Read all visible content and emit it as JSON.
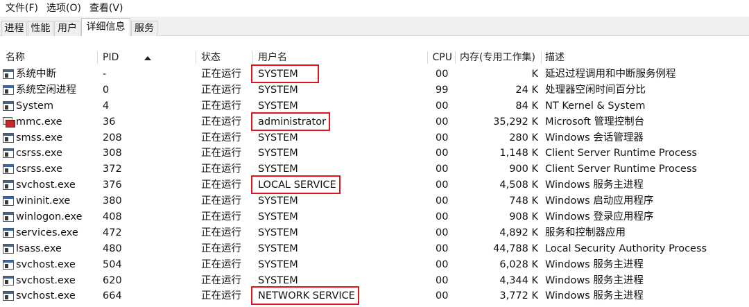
{
  "menu": [
    "文件(F)",
    "选项(O)",
    "查看(V)"
  ],
  "tabs": [
    "进程",
    "性能",
    "用户",
    "详细信息",
    "服务"
  ],
  "active_tab": "详细信息",
  "columns": {
    "name": "名称",
    "pid": "PID",
    "status": "状态",
    "user": "用户名",
    "cpu": "CPU",
    "memory": "内存(专用工作集)",
    "description": "描述"
  },
  "sort": {
    "column": "PID",
    "direction": "ascending"
  },
  "highlight_color": "#e0141e",
  "rows": [
    {
      "name": "系统中断",
      "pid": "-",
      "status": "正在运行",
      "user": "SYSTEM",
      "cpu": "00",
      "memory": "K",
      "description": "延迟过程调用和中断服务例程",
      "icon": "window-icon",
      "highlighted": true
    },
    {
      "name": "系统空闲进程",
      "pid": "0",
      "status": "正在运行",
      "user": "SYSTEM",
      "cpu": "99",
      "memory": "24 K",
      "description": "处理器空闲时间百分比",
      "icon": "window-icon",
      "highlighted": false
    },
    {
      "name": "System",
      "pid": "4",
      "status": "正在运行",
      "user": "SYSTEM",
      "cpu": "00",
      "memory": "84 K",
      "description": "NT Kernel & System",
      "icon": "window-icon",
      "highlighted": false
    },
    {
      "name": "mmc.exe",
      "pid": "36",
      "status": "正在运行",
      "user": "administrator",
      "cpu": "00",
      "memory": "35,292 K",
      "description": "Microsoft 管理控制台",
      "icon": "mmc-icon",
      "highlighted": true
    },
    {
      "name": "smss.exe",
      "pid": "208",
      "status": "正在运行",
      "user": "SYSTEM",
      "cpu": "00",
      "memory": "280 K",
      "description": "Windows 会话管理器",
      "icon": "window-icon",
      "highlighted": false
    },
    {
      "name": "csrss.exe",
      "pid": "308",
      "status": "正在运行",
      "user": "SYSTEM",
      "cpu": "00",
      "memory": "1,148 K",
      "description": "Client Server Runtime Process",
      "icon": "window-icon",
      "highlighted": false
    },
    {
      "name": "csrss.exe",
      "pid": "372",
      "status": "正在运行",
      "user": "SYSTEM",
      "cpu": "00",
      "memory": "900 K",
      "description": "Client Server Runtime Process",
      "icon": "window-icon",
      "highlighted": false
    },
    {
      "name": "svchost.exe",
      "pid": "376",
      "status": "正在运行",
      "user": "LOCAL SERVICE",
      "cpu": "00",
      "memory": "4,508 K",
      "description": "Windows 服务主进程",
      "icon": "window-icon",
      "highlighted": true
    },
    {
      "name": "wininit.exe",
      "pid": "380",
      "status": "正在运行",
      "user": "SYSTEM",
      "cpu": "00",
      "memory": "748 K",
      "description": "Windows 启动应用程序",
      "icon": "window-icon",
      "highlighted": false
    },
    {
      "name": "winlogon.exe",
      "pid": "408",
      "status": "正在运行",
      "user": "SYSTEM",
      "cpu": "00",
      "memory": "908 K",
      "description": "Windows 登录应用程序",
      "icon": "window-icon",
      "highlighted": false
    },
    {
      "name": "services.exe",
      "pid": "472",
      "status": "正在运行",
      "user": "SYSTEM",
      "cpu": "00",
      "memory": "4,892 K",
      "description": "服务和控制器应用",
      "icon": "window-icon",
      "highlighted": false
    },
    {
      "name": "lsass.exe",
      "pid": "480",
      "status": "正在运行",
      "user": "SYSTEM",
      "cpu": "00",
      "memory": "44,788 K",
      "description": "Local Security Authority Process",
      "icon": "window-icon",
      "highlighted": false
    },
    {
      "name": "svchost.exe",
      "pid": "504",
      "status": "正在运行",
      "user": "SYSTEM",
      "cpu": "00",
      "memory": "6,028 K",
      "description": "Windows 服务主进程",
      "icon": "window-icon",
      "highlighted": false
    },
    {
      "name": "svchost.exe",
      "pid": "620",
      "status": "正在运行",
      "user": "SYSTEM",
      "cpu": "00",
      "memory": "4,344 K",
      "description": "Windows 服务主进程",
      "icon": "window-icon",
      "highlighted": false
    },
    {
      "name": "svchost.exe",
      "pid": "664",
      "status": "正在运行",
      "user": "NETWORK SERVICE",
      "cpu": "00",
      "memory": "3,772 K",
      "description": "Windows 服务主进程",
      "icon": "window-icon",
      "highlighted": true
    }
  ]
}
